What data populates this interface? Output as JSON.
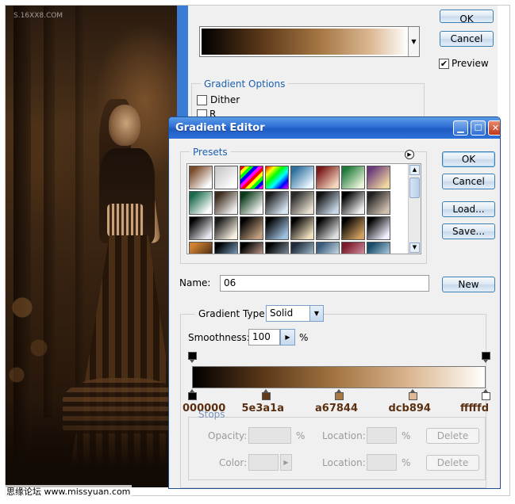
{
  "watermark": "S.16XX8.COM",
  "footer": "思缘论坛 www.missyuan.com",
  "overlay_dialog": {
    "ok": "OK",
    "cancel": "Cancel",
    "preview_label": "Preview",
    "preview_checked": true,
    "gradient_options_title": "Gradient Options",
    "dither_label": "Dither",
    "dither_checked": false,
    "reverse_label_partial": "R"
  },
  "gradient_editor": {
    "title": "Gradient Editor",
    "presets_title": "Presets",
    "buttons": {
      "ok": "OK",
      "cancel": "Cancel",
      "load": "Load...",
      "save": "Save...",
      "new": "New"
    },
    "name_label": "Name:",
    "name_value": "06",
    "gradient_type_label": "Gradient Type:",
    "gradient_type_value": "Solid",
    "smoothness_label": "Smoothness:",
    "smoothness_value": "100",
    "smoothness_unit": "%",
    "color_stops": [
      {
        "hex": "000000",
        "color": "#000000",
        "location": 0
      },
      {
        "hex": "5e3a1a",
        "color": "#5e3a1a",
        "location": 25
      },
      {
        "hex": "a67844",
        "color": "#a67844",
        "location": 50
      },
      {
        "hex": "dcb894",
        "color": "#dcb894",
        "location": 75
      },
      {
        "hex": "fffffd",
        "color": "#fffffd",
        "location": 100
      }
    ],
    "opacity_stops": [
      {
        "location": 0,
        "opacity": 100
      },
      {
        "location": 100,
        "opacity": 100
      }
    ],
    "stops": {
      "title": "Stops",
      "opacity_label": "Opacity:",
      "opacity_unit": "%",
      "location_label": "Location:",
      "location_unit": "%",
      "color_label": "Color:",
      "delete": "Delete"
    },
    "presets": [
      [
        "#7a4a2a",
        "#ffffff"
      ],
      [
        "#cccccc",
        "#ffffff"
      ],
      [
        "rainbow-diag",
        ""
      ],
      [
        "rainbow",
        ""
      ],
      [
        "#2d6f9c",
        "#eaf6ff"
      ],
      [
        "#7a1a1a",
        "#f6d7c0"
      ],
      [
        "#1f7a3a",
        "#e8f3d8"
      ],
      [
        "#6a3a7a",
        "#f0d7a0"
      ],
      [
        "#1a6a4a",
        "#ffffff"
      ],
      [
        "#3a2a1a",
        "#f0f0f0"
      ],
      [
        "#0a3a1a",
        "#f5f5f5"
      ],
      [
        "#1a1a1a",
        "#d9e6f5"
      ],
      [
        "#2a2a2a",
        "#e8e0d0"
      ],
      [
        "#101010",
        "#c8d8e8"
      ],
      [
        "#000000",
        "#f0f0f0"
      ],
      [
        "#202020",
        "#d0c0b0"
      ],
      [
        "#000000",
        "#e8e8f0"
      ],
      [
        "#1a1a1a",
        "#f8f0e0"
      ],
      [
        "#000000",
        "#c0a080"
      ],
      [
        "#000000",
        "#a0c0e0"
      ],
      [
        "#000000",
        "#f0e0c0"
      ],
      [
        "#000000",
        "#e0e0e0"
      ],
      [
        "#000000",
        "#d0a060"
      ],
      [
        "#000000",
        "#f0f0ff"
      ],
      [
        "#d08030",
        "#3a2010"
      ],
      [
        "#000000",
        "#8ab4d8"
      ],
      [
        "#000000",
        "#d8b0a0"
      ],
      [
        "#000000",
        "#90a0b0"
      ],
      [
        "#202a3a",
        "#b0d0e0"
      ],
      [
        "#3a5a7a",
        "#e0f0f8"
      ],
      [
        "#7a1a2a",
        "#e0a0b0"
      ],
      [
        "#1a4a6a",
        "#c0e0f0"
      ]
    ]
  }
}
